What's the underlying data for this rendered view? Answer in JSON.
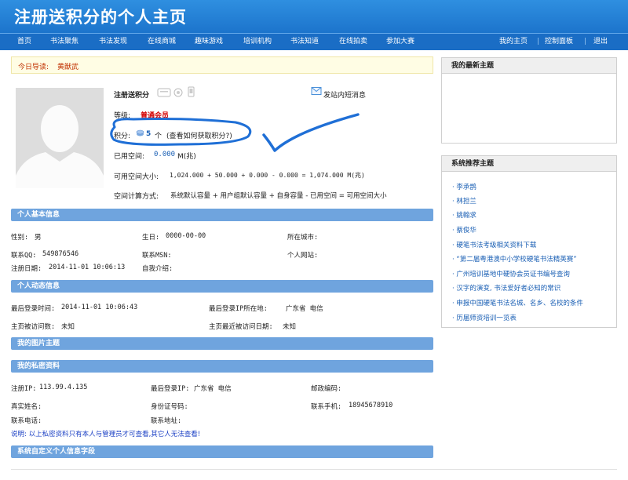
{
  "header": {
    "title": "注册送积分的个人主页"
  },
  "nav": {
    "left": [
      "首页",
      "书法聚焦",
      "书法发现",
      "在线商城",
      "趣味游戏",
      "培训机构",
      "书法知道",
      "在线拍卖",
      "参加大赛"
    ],
    "right": [
      "我的主页",
      "控制面板",
      "退出"
    ],
    "sep": "|"
  },
  "notice": {
    "label": "今日导读:",
    "link": "黄猷武"
  },
  "profile": {
    "username": "注册送积分",
    "message_link": "发站内短消息",
    "level_label": "等级:",
    "level_value": "普通会员",
    "points_label": "积分:",
    "points_value": "5",
    "points_unit": "个",
    "points_help": "(查看如何获取积分?)",
    "used_label": "已用空间:",
    "used_value": "0.000",
    "used_unit": "M(兆)",
    "avail_label": "可用空间大小:",
    "avail_value": "1,024.000 + 50.000 + 0.000 - 0.000 = 1,074.000 M(兆)",
    "formula_label": "空间计算方式:",
    "formula_value": "系统默认容量 + 用户组默认容量 + 自身容量 - 已用空间 = 可用空间大小"
  },
  "basic": {
    "title": "个人基本信息",
    "gender_label": "性别:",
    "gender": "男",
    "birthday_label": "生日:",
    "birthday": "0000-00-00",
    "city_label": "所在城市:",
    "qq_label": "联系QQ:",
    "qq": "549876546",
    "msn_label": "联系MSN:",
    "site_label": "个人网站:",
    "reg_label": "注册日期:",
    "reg": "2014-11-01 10:06:13",
    "intro_label": "自我介绍:"
  },
  "activity": {
    "title": "个人动态信息",
    "last_login_label": "最后登录时间:",
    "last_login": "2014-11-01 10:06:43",
    "last_ip_loc_label": "最后登录IP所在地:",
    "last_ip_loc": "广东省 电信",
    "visits_label": "主页被访问数:",
    "visits": "未知",
    "last_visit_label": "主页最近被访问日期:",
    "last_visit": "未知"
  },
  "pictures": {
    "title": "我的图片主题"
  },
  "private": {
    "title": "我的私密资料",
    "reg_ip_label": "注册IP:",
    "reg_ip": "113.99.4.135",
    "last_ip_label": "最后登录IP:",
    "last_ip": "广东省 电信",
    "zip_label": "邮政编码:",
    "name_label": "真实姓名:",
    "id_label": "身份证号码:",
    "mobile_label": "联系手机:",
    "mobile": "18945678910",
    "phone_label": "联系电话:",
    "addr_label": "联系地址:",
    "note": "说明: 以上私密资料只有本人与管理员才可查看,其它人无法查看!"
  },
  "custom": {
    "title": "系统自定义个人信息字段"
  },
  "right": {
    "latest_title": "我的最新主题",
    "recommend_title": "系统推荐主题",
    "items": [
      "· 李承鹊",
      "· 林担兰",
      "· 姚翰求",
      "· 蔡俊华",
      "· 硬笔书法考级相关资料下载",
      "· “第二届粤港澳中小学校硬笔书法精英赛”",
      "· 广州培训基地中硬协会员证书编号查询",
      "· 汉字的演变, 书法爱好者必知的常识",
      "· 申报中国硬笔书法名城、名乡、名校的条件",
      "· 历届师资培训一览表"
    ]
  },
  "colors": {
    "accent": "#1a6dc5",
    "annotation": "#1f6fd6"
  }
}
